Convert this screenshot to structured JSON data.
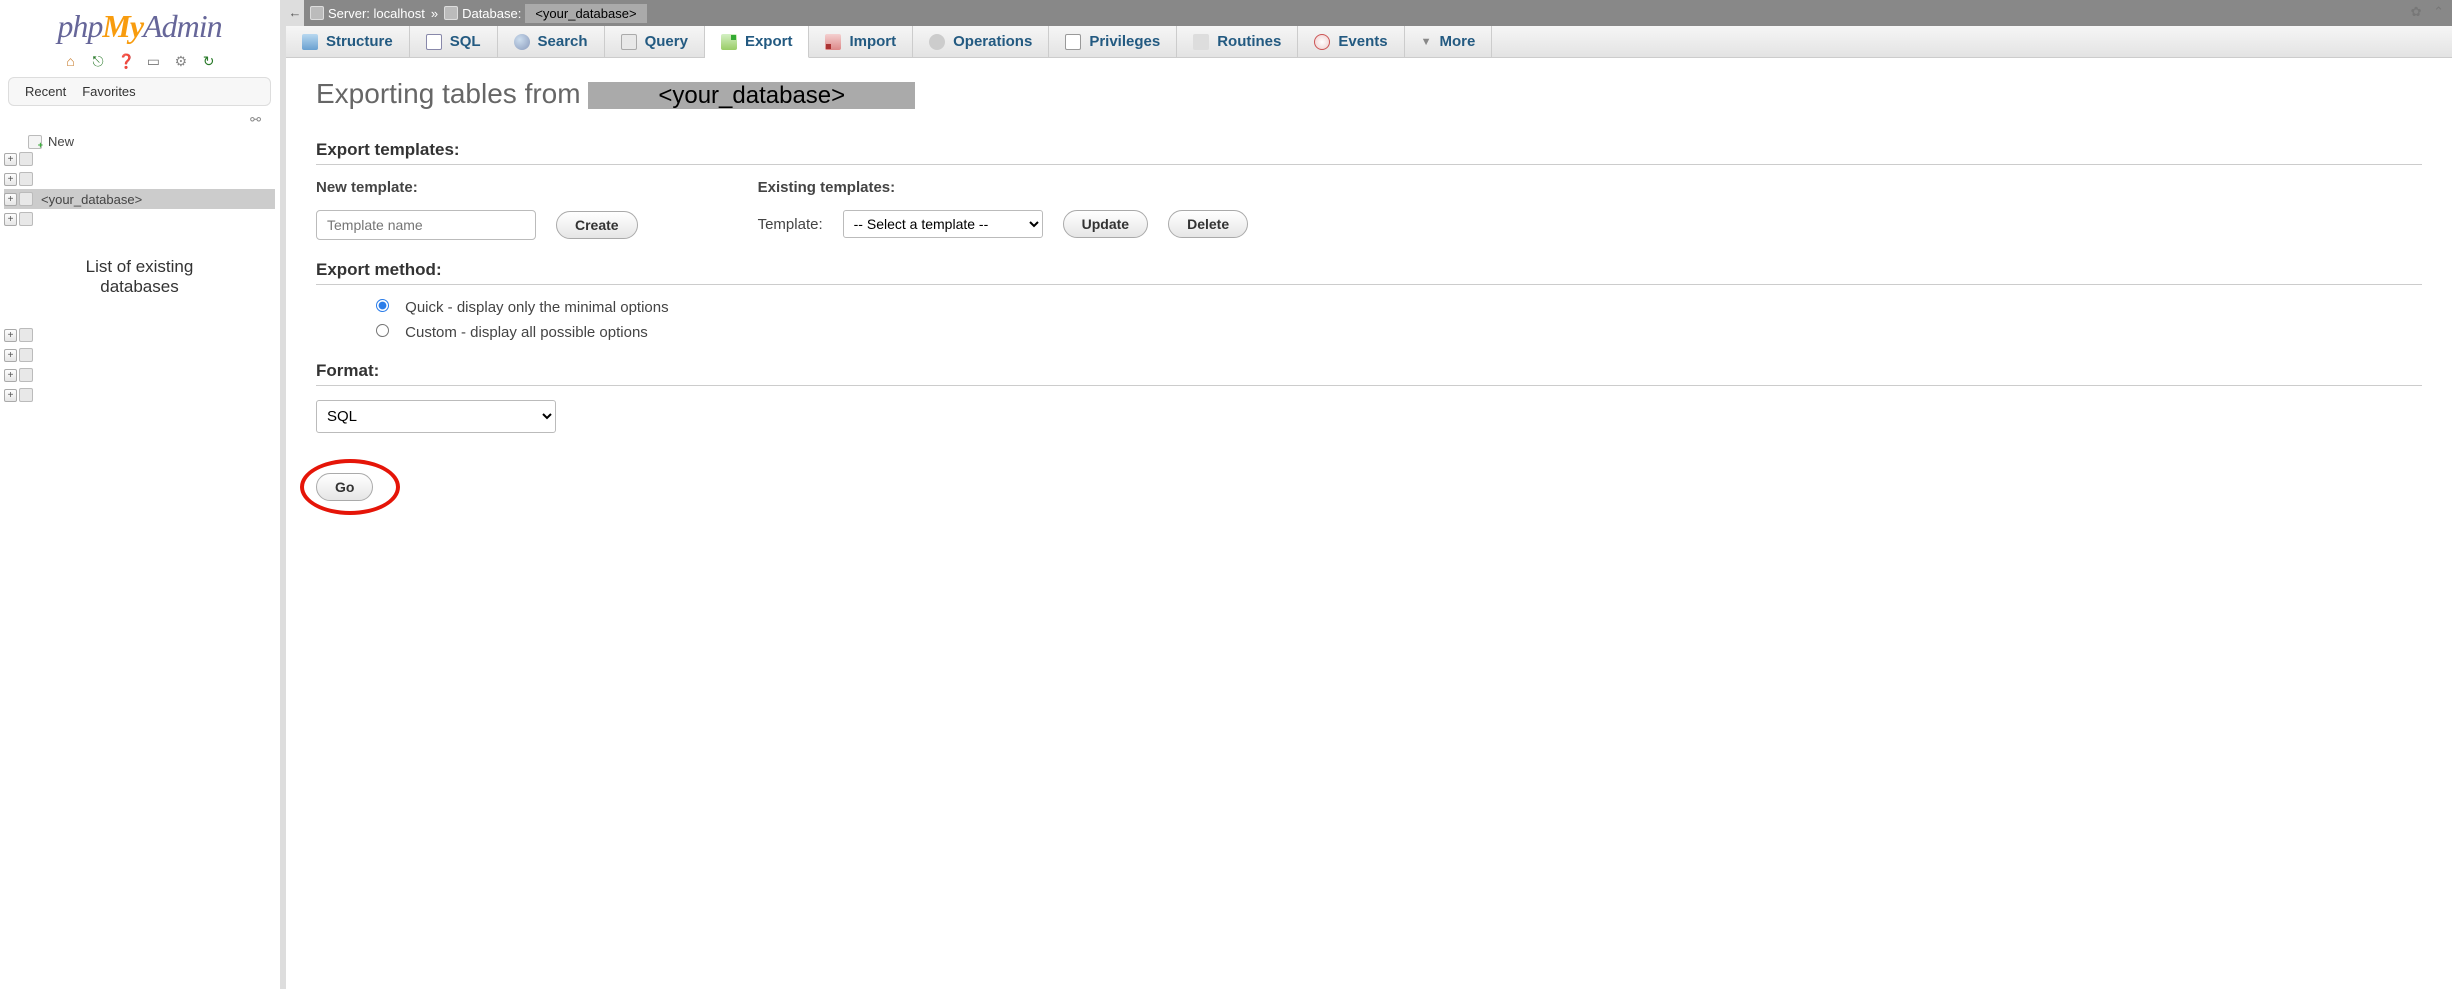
{
  "logo": {
    "php": "php",
    "my": "My",
    "admin": "Admin"
  },
  "sidebar": {
    "recent": "Recent",
    "favorites": "Favorites",
    "new_label": "New",
    "your_db": "<your_database>",
    "caption_line1": "List of existing",
    "caption_line2": "databases"
  },
  "breadcrumb": {
    "server_label": "Server:",
    "server_value": "localhost",
    "sep": "»",
    "database_label": "Database:",
    "database_value": "<your_database>"
  },
  "tabs": {
    "structure": "Structure",
    "sql": "SQL",
    "search": "Search",
    "query": "Query",
    "export": "Export",
    "import": "Import",
    "operations": "Operations",
    "privileges": "Privileges",
    "routines": "Routines",
    "events": "Events",
    "more": "More"
  },
  "page": {
    "title_prefix": "Exporting tables from ",
    "title_db": "<your_database>"
  },
  "sections": {
    "export_templates": "Export templates:",
    "new_template": "New template:",
    "existing_templates": "Existing templates:",
    "template_label": "Template:",
    "template_placeholder": "Template name",
    "template_select_default": "-- Select a template --",
    "create": "Create",
    "update": "Update",
    "delete": "Delete",
    "export_method": "Export method:",
    "quick": "Quick - display only the minimal options",
    "custom": "Custom - display all possible options",
    "format": "Format:",
    "format_value": "SQL",
    "go": "Go"
  }
}
